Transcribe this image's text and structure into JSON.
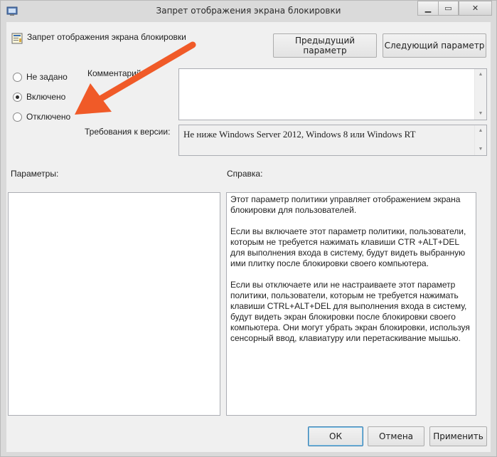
{
  "window": {
    "title": "Запрет отображения экрана блокировки",
    "min_glyph": "▁",
    "max_glyph": "▭",
    "close_glyph": "✕"
  },
  "header": {
    "policy_title": "Запрет отображения экрана блокировки",
    "prev_button": "Предыдущий параметр",
    "next_button": "Следующий параметр"
  },
  "state": {
    "options": [
      {
        "label": "Не задано",
        "checked": false
      },
      {
        "label": "Включено",
        "checked": true
      },
      {
        "label": "Отключено",
        "checked": false
      }
    ]
  },
  "comment": {
    "label": "Комментарий:",
    "value": ""
  },
  "supported": {
    "label": "Требования к версии:",
    "value": "Не ниже Windows Server 2012, Windows 8 или Windows RT"
  },
  "options_label": "Параметры:",
  "help_label": "Справка:",
  "help_text": {
    "p1": "Этот параметр политики управляет отображением экрана блокировки для пользователей.",
    "p2": "Если вы включаете этот параметр политики, пользователи, которым не требуется нажимать клавиши CTR +ALT+DEL для выполнения входа в систему, будут видеть выбранную ими плитку после блокировки своего компьютера.",
    "p3": "Если вы отключаете или не настраиваете этот параметр политики, пользователи, которым не требуется нажимать клавиши CTRL+ALT+DEL для выполнения входа в систему, будут видеть экран блокировки после блокировки своего компьютера. Они могут убрать экран блокировки, используя сенсорный ввод, клавиатуру или перетаскивание мышью."
  },
  "footer": {
    "ok": "ОК",
    "cancel": "Отмена",
    "apply": "Применить"
  },
  "colors": {
    "annotation_arrow": "#f05a28",
    "window_frame": "#dadada",
    "dialog_bg": "#f0f0f0"
  }
}
